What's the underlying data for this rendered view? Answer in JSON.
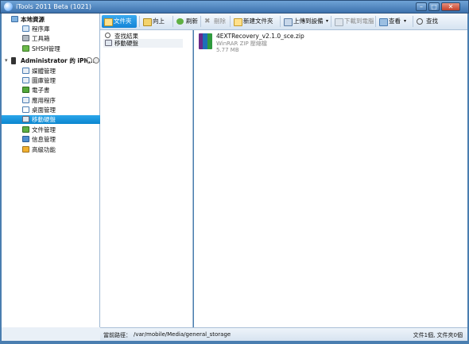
{
  "window": {
    "title": "iTools 2011 Beta (1021)",
    "minimize": "–",
    "maximize": "□",
    "close": "✕"
  },
  "sidebar": {
    "local_group": "本地資源",
    "local_items": [
      "程序庫",
      "工具箱",
      "SHSH管理"
    ],
    "device_group": "Administrator 的 iPh...",
    "device_items": [
      "媒體管理",
      "圖庫管理",
      "電子書",
      "應用程序",
      "桌面管理",
      "移動硬盤",
      "文件管理",
      "信息管理",
      "高級功能"
    ]
  },
  "toolbar": {
    "folder": "文件夾",
    "up": "向上",
    "refresh": "刷新",
    "delete": "刪除",
    "new_folder": "新建文件夾",
    "upload": "上傳到設備",
    "download": "下載到電腦",
    "view": "查看",
    "search": "查找"
  },
  "folders": {
    "items": [
      "查找結果",
      "移動硬盤"
    ]
  },
  "files": {
    "items": [
      {
        "name": "4EXTRecovery_v2.1.0_sce.zip",
        "type": "WinRAR ZIP 壓縮檔",
        "size": "5.77 MB"
      }
    ]
  },
  "status": {
    "path_label": "當前路徑：",
    "path": "/var/mobile/Media/general_storage",
    "summary": "文件1個, 文件夾0個"
  },
  "colors": {
    "accent": "#1a93de",
    "titlebar": "#3d72ad"
  }
}
